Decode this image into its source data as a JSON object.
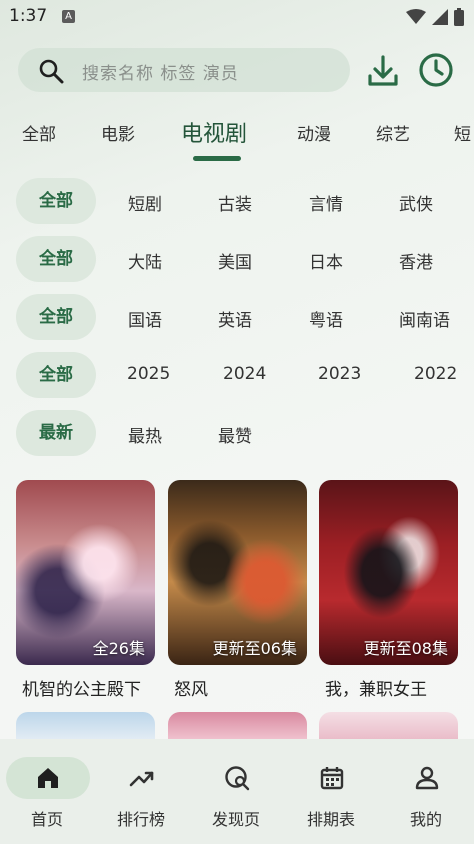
{
  "status_bar": {
    "time": "1:37",
    "app_indicator": "A",
    "icons": [
      "wifi-icon",
      "signal-icon",
      "battery-icon"
    ]
  },
  "search": {
    "placeholder": "搜索名称 标签 演员",
    "icon": "search-icon"
  },
  "header_actions": {
    "download_icon": "download-icon",
    "history_icon": "clock-icon"
  },
  "category_tabs": [
    {
      "label": "全部",
      "active": false
    },
    {
      "label": "电影",
      "active": false
    },
    {
      "label": "电视剧",
      "active": true
    },
    {
      "label": "动漫",
      "active": false
    },
    {
      "label": "综艺",
      "active": false
    },
    {
      "label": "短",
      "active": false
    }
  ],
  "filters": [
    {
      "selected": "全部",
      "options": [
        "短剧",
        "古装",
        "言情",
        "武侠"
      ]
    },
    {
      "selected": "全部",
      "options": [
        "大陆",
        "美国",
        "日本",
        "香港"
      ]
    },
    {
      "selected": "全部",
      "options": [
        "国语",
        "英语",
        "粤语",
        "闽南语"
      ]
    },
    {
      "selected": "全部",
      "options": [
        "2025",
        "2024",
        "2023",
        "2022"
      ]
    },
    {
      "selected": "最新",
      "options": [
        "最热",
        "最赞"
      ]
    }
  ],
  "cards": [
    {
      "title": "机智的公主殿下",
      "badge": "全26集"
    },
    {
      "title": "怒风",
      "badge": "更新至06集"
    },
    {
      "title": "我，兼职女王",
      "badge": "更新至08集"
    }
  ],
  "bottom_nav": [
    {
      "label": "首页",
      "icon": "home-icon",
      "active": true
    },
    {
      "label": "排行榜",
      "icon": "trending-icon",
      "active": false
    },
    {
      "label": "发现页",
      "icon": "discover-icon",
      "active": false
    },
    {
      "label": "排期表",
      "icon": "calendar-icon",
      "active": false
    },
    {
      "label": "我的",
      "icon": "profile-icon",
      "active": false
    }
  ],
  "colors": {
    "accent": "#2a6b46",
    "chip_bg": "#dde8de",
    "nav_bg": "#eaefea"
  }
}
